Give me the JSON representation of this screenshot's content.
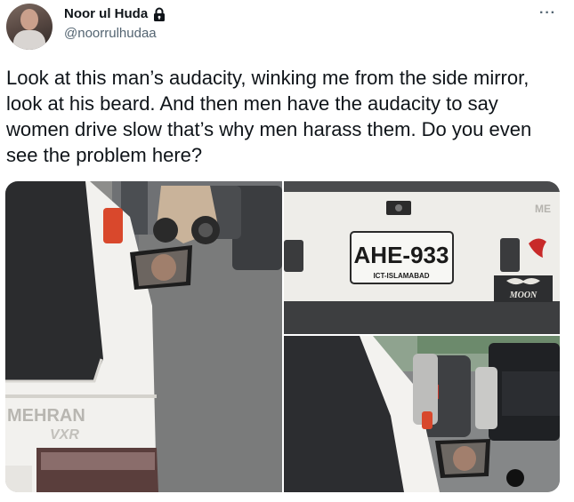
{
  "user": {
    "name": "Noor ul Huda",
    "handle": "@noorrulhudaa",
    "protected_icon": "lock-icon"
  },
  "more_label": "···",
  "tweet": {
    "text": "Look at this man’s audacity, winking me from the side mirror, look at his beard. And then men have the audacity to say women drive slow that’s why men harass them. Do you even see the problem here?"
  },
  "media": {
    "photo1": {
      "badge_line1": "MEHRAN",
      "badge_line2": "VXR"
    },
    "photo2": {
      "plate_number": "AHE-933",
      "plate_city": "ICT-ISLAMABAD",
      "sticker_text": "MOON",
      "brand_fragment": "ME"
    }
  },
  "colors": {
    "text": "#0f1419",
    "secondary": "#536471"
  }
}
